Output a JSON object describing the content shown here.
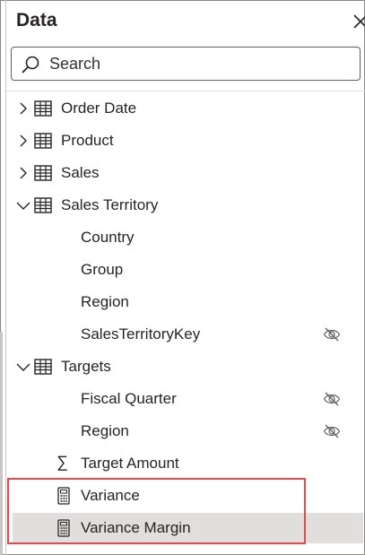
{
  "panel": {
    "title": "Data"
  },
  "search": {
    "placeholder": "Search"
  },
  "tables": [
    {
      "label": "Order Date",
      "expanded": false
    },
    {
      "label": "Product",
      "expanded": false
    },
    {
      "label": "Sales",
      "expanded": false
    },
    {
      "label": "Sales Territory",
      "expanded": true,
      "fields": [
        {
          "label": "Country",
          "hidden": false
        },
        {
          "label": "Group",
          "hidden": false
        },
        {
          "label": "Region",
          "hidden": false
        },
        {
          "label": "SalesTerritoryKey",
          "hidden": true
        }
      ]
    },
    {
      "label": "Targets",
      "expanded": true,
      "fields": [
        {
          "label": "Fiscal Quarter",
          "hidden": true
        },
        {
          "label": "Region",
          "hidden": true
        },
        {
          "label": "Target Amount",
          "icon": "sigma-icon"
        },
        {
          "label": "Variance",
          "icon": "calculator-icon"
        },
        {
          "label": "Variance Margin",
          "icon": "calculator-icon",
          "selected": true
        }
      ]
    }
  ],
  "colors": {
    "highlight": "#e8474c",
    "selected_row": "#e1dfdd"
  }
}
